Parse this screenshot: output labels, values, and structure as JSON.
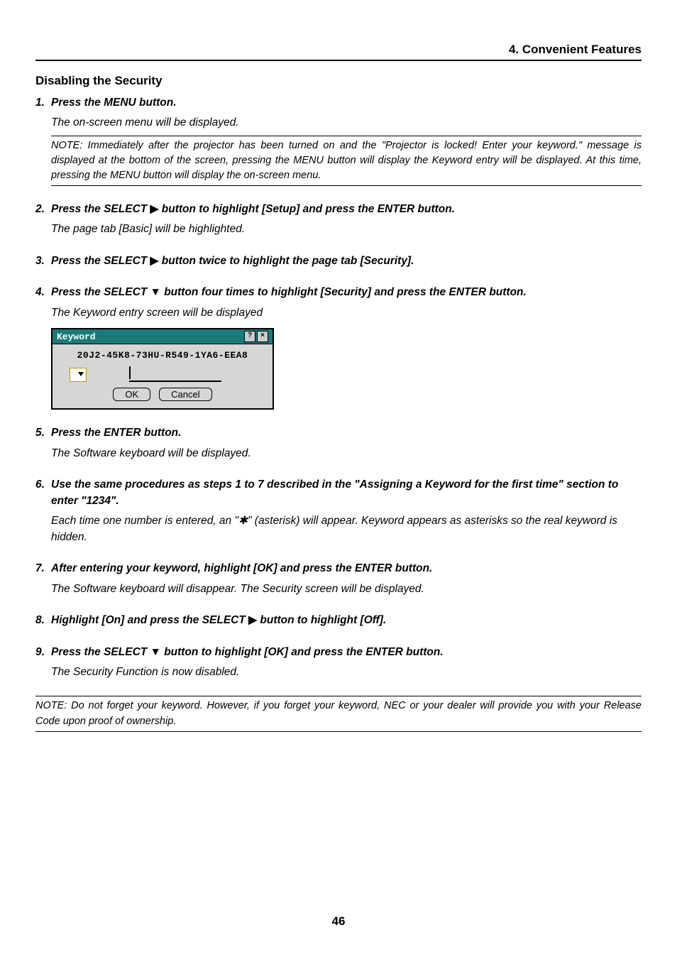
{
  "header": {
    "chapter": "4. Convenient Features"
  },
  "section_title": "Disabling the Security",
  "steps": [
    {
      "num": "1.",
      "head": "Press the MENU button.",
      "sub": "The on-screen menu will be displayed.",
      "note": "NOTE: Immediately after the projector has been turned on and the \"Projector is locked! Enter your keyword.\" message is displayed at the bottom of the screen, pressing the MENU button will display the Keyword entry will be displayed. At this time, pressing the MENU button will display the on-screen menu."
    },
    {
      "num": "2.",
      "head_pre": "Press the SELECT ",
      "arrow": "▶",
      "head_post": " button to highlight [Setup] and press the ENTER button.",
      "sub": "The page tab [Basic] will be highlighted."
    },
    {
      "num": "3.",
      "head_pre": "Press the SELECT ",
      "arrow": "▶",
      "head_post": " button twice to highlight the page tab [Security]."
    },
    {
      "num": "4.",
      "head_pre": "Press the SELECT ",
      "arrow": "▼",
      "head_post": " button four times to highlight [Security] and press the ENTER button.",
      "sub": "The Keyword entry screen will be displayed"
    },
    {
      "num": "5.",
      "head": "Press the ENTER button.",
      "sub": "The Software keyboard will be displayed."
    },
    {
      "num": "6.",
      "head": "Use the same procedures as steps 1 to 7 described in the \"Assigning a Keyword for the first time\" section to enter \"1234\".",
      "sub": "Each time one number is entered, an \"✱\" (asterisk) will appear. Keyword appears as asterisks so the real keyword is hidden."
    },
    {
      "num": "7.",
      "head": "After entering your keyword, highlight [OK] and press the ENTER button.",
      "sub": "The Software keyboard will disappear. The Security screen will be displayed."
    },
    {
      "num": "8.",
      "head_pre": "Highlight [On] and press the SELECT ",
      "arrow": "▶",
      "head_post": " button to highlight [Off]."
    },
    {
      "num": "9.",
      "head_pre": "Press the SELECT ",
      "arrow": "▼",
      "head_post": " button to highlight [OK] and press the ENTER button.",
      "sub": "The Security Function is now disabled."
    }
  ],
  "dialog": {
    "title": "Keyword",
    "code": "20J2-45K8-73HU-R549-1YA6-EEA8",
    "ok": "OK",
    "cancel": "Cancel",
    "help_icon": "?",
    "close_icon": "×"
  },
  "final_note": "NOTE: Do not forget your keyword. However, if you forget your keyword, NEC or your dealer will provide you with your Release Code upon proof of ownership.",
  "page_number": "46"
}
